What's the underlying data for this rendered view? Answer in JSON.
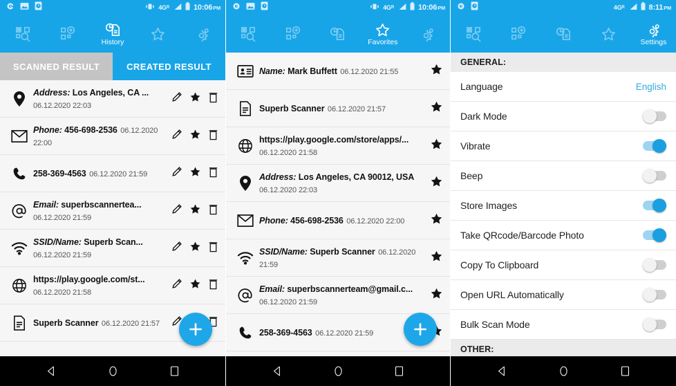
{
  "app": {
    "accent": "#18a5e8",
    "fab_color": "#1ea7e8",
    "toggle_on_color": "#1c9fe0"
  },
  "nav_icons": {
    "back": "back-triangle-icon",
    "home": "home-circle-icon",
    "recents": "recents-square-icon"
  },
  "toolbar": {
    "items": [
      {
        "icon": "scan-qr-icon",
        "label": "Scan"
      },
      {
        "icon": "create-qr-icon",
        "label": "Create"
      },
      {
        "icon": "history-icon",
        "label": "History"
      },
      {
        "icon": "favorites-star-icon",
        "label": "Favorites"
      },
      {
        "icon": "settings-gear-icon",
        "label": "Settings"
      }
    ]
  },
  "screens": [
    {
      "id": "history",
      "active_toolbar_index": 2,
      "active_toolbar_label": "History",
      "statusbar": {
        "time": "10:06",
        "ampm": "PM",
        "network": "4G",
        "roaming": "R",
        "left_icons": [
          "sync-icon",
          "screenshot-icon",
          "clock-doc-icon"
        ],
        "right_icons": [
          "vibrate-icon",
          "signal-icon",
          "battery-icon"
        ]
      },
      "tabs": [
        {
          "label": "SCANNED RESULT",
          "active": false
        },
        {
          "label": "CREATED RESULT",
          "active": true
        }
      ],
      "fab": {
        "label": "+",
        "icon": "plus-icon"
      },
      "row_actions": [
        "edit-pencil-icon",
        "favorite-star-icon",
        "delete-trash-icon"
      ],
      "rows": [
        {
          "icon": "location-pin-icon",
          "prefix": "Address:",
          "value": " Los Angeles, CA ...",
          "date": "06.12.2020 22:03"
        },
        {
          "icon": "envelope-icon",
          "prefix": "Phone:",
          "value": " 456-698-2536",
          "date": "06.12.2020 22:00"
        },
        {
          "icon": "phone-icon",
          "prefix": "",
          "value": "258-369-4563",
          "date": "06.12.2020 21:59"
        },
        {
          "icon": "at-sign-icon",
          "prefix": "Email:",
          "value": " superbscannertea...",
          "date": "06.12.2020 21:59"
        },
        {
          "icon": "wifi-icon",
          "prefix": "SSID/Name:",
          "value": " Superb Scan...",
          "date": "06.12.2020 21:59"
        },
        {
          "icon": "globe-icon",
          "prefix": "",
          "value": "https://play.google.com/st...",
          "date": "06.12.2020 21:58"
        },
        {
          "icon": "document-icon",
          "prefix": "",
          "value": "Superb Scanner",
          "date": "06.12.2020 21:57"
        }
      ]
    },
    {
      "id": "favorites",
      "active_toolbar_index": 3,
      "active_toolbar_label": "Favorites",
      "statusbar": {
        "time": "10:06",
        "ampm": "PM",
        "network": "4G",
        "roaming": "R",
        "left_icons": [
          "sync-icon",
          "screenshot-icon",
          "clock-doc-icon"
        ],
        "right_icons": [
          "vibrate-icon",
          "signal-icon",
          "battery-icon"
        ]
      },
      "fab": {
        "label": "+",
        "icon": "plus-icon"
      },
      "row_actions": [
        "favorite-star-icon"
      ],
      "rows": [
        {
          "icon": "contact-card-icon",
          "prefix": "Name:",
          "value": " Mark Buffett",
          "date": "06.12.2020 21:55"
        },
        {
          "icon": "document-icon",
          "prefix": "",
          "value": "Superb Scanner",
          "date": "06.12.2020 21:57"
        },
        {
          "icon": "globe-icon",
          "prefix": "",
          "value": "https://play.google.com/store/apps/...",
          "date": "06.12.2020 21:58"
        },
        {
          "icon": "location-pin-icon",
          "prefix": "Address:",
          "value": " Los Angeles, CA 90012, USA",
          "date": "06.12.2020 22:03"
        },
        {
          "icon": "envelope-icon",
          "prefix": "Phone:",
          "value": " 456-698-2536",
          "date": "06.12.2020 22:00"
        },
        {
          "icon": "wifi-icon",
          "prefix": "SSID/Name:",
          "value": " Superb Scanner",
          "date": "06.12.2020 21:59"
        },
        {
          "icon": "at-sign-icon",
          "prefix": "Email:",
          "value": " superbscannerteam@gmail.c...",
          "date": "06.12.2020 21:59"
        },
        {
          "icon": "phone-icon",
          "prefix": "",
          "value": "258-369-4563",
          "date": "06.12.2020 21:59"
        }
      ]
    },
    {
      "id": "settings",
      "active_toolbar_index": 4,
      "active_toolbar_label": "Settings",
      "statusbar": {
        "time": "8:11",
        "ampm": "PM",
        "network": "4G",
        "roaming": "R",
        "left_icons": [
          "sync-icon",
          "clock-doc-icon"
        ],
        "right_icons": [
          "signal-icon",
          "battery-icon"
        ]
      },
      "section_general": "GENERAL:",
      "section_other": "OTHER:",
      "settings": [
        {
          "label": "Language",
          "type": "value",
          "value": "English"
        },
        {
          "label": "Dark Mode",
          "type": "toggle",
          "on": false
        },
        {
          "label": "Vibrate",
          "type": "toggle",
          "on": true
        },
        {
          "label": "Beep",
          "type": "toggle",
          "on": false
        },
        {
          "label": "Store Images",
          "type": "toggle",
          "on": true
        },
        {
          "label": "Take QRcode/Barcode Photo",
          "type": "toggle",
          "on": true
        },
        {
          "label": "Copy To Clipboard",
          "type": "toggle",
          "on": false
        },
        {
          "label": "Open URL Automatically",
          "type": "toggle",
          "on": false
        },
        {
          "label": "Bulk Scan Mode",
          "type": "toggle",
          "on": false
        }
      ]
    }
  ]
}
